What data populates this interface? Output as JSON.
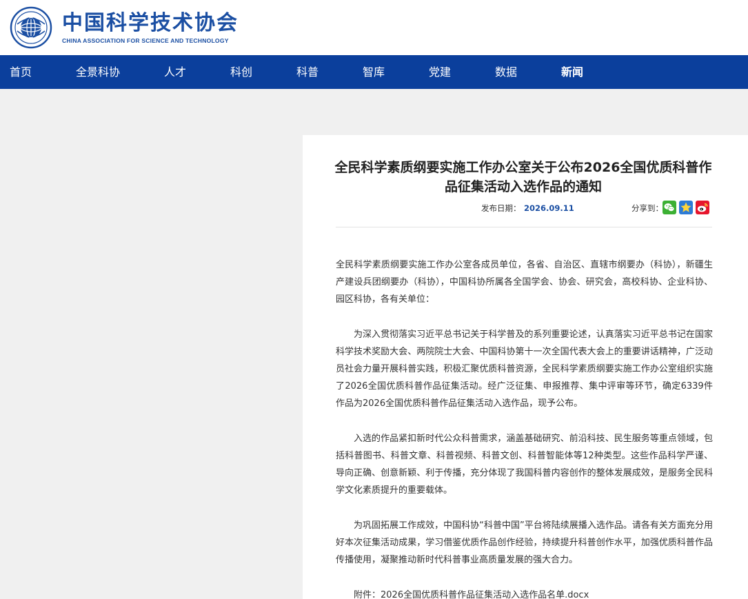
{
  "header": {
    "logo_cn": "中国科学技术协会",
    "logo_en": "CHINA ASSOCIATION FOR SCIENCE AND TECHNOLOGY"
  },
  "nav": {
    "items": [
      {
        "label": "首页"
      },
      {
        "label": "全景科协"
      },
      {
        "label": "人才"
      },
      {
        "label": "科创"
      },
      {
        "label": "科普"
      },
      {
        "label": "智库"
      },
      {
        "label": "党建"
      },
      {
        "label": "数据"
      },
      {
        "label": "新闻"
      }
    ],
    "active": "新闻"
  },
  "article": {
    "title": "全民科学素质纲要实施工作办公室关于公布2026全国优质科普作品征集活动入选作品的通知",
    "date_label": "发布日期：",
    "date": "2026.09.11",
    "share_label": "分享到：",
    "share_icons": [
      "wechat-icon",
      "qzone-icon",
      "weibo-icon"
    ],
    "paragraphs": [
      "全民科学素质纲要实施工作办公室各成员单位，各省、自治区、直辖市纲要办（科协），新疆生产建设兵团纲要办（科协），中国科协所属各全国学会、协会、研究会，高校科协、企业科协、园区科协，各有关单位：",
      "为深入贯彻落实习近平总书记关于科学普及的系列重要论述，认真落实习近平总书记在国家科学技术奖励大会、两院院士大会、中国科协第十一次全国代表大会上的重要讲话精神，广泛动员社会力量开展科普实践，积极汇聚优质科普资源，全民科学素质纲要实施工作办公室组织实施了2026全国优质科普作品征集活动。经广泛征集、申报推荐、集中评审等环节，确定6339件作品为2026全国优质科普作品征集活动入选作品，现予公布。",
      "入选的作品紧扣新时代公众科普需求，涵盖基础研究、前沿科技、民生服务等重点领域，包括科普图书、科普文章、科普视频、科普文创、科普智能体等12种类型。这些作品科学严谨、导向正确、创意新颖、利于传播，充分体现了我国科普内容创作的整体发展成效，是服务全民科学文化素质提升的重要载体。",
      "为巩固拓展工作成效，中国科协“科普中国”平台将陆续展播入选作品。请各有关方面充分用好本次征集活动成果，学习借鉴优质作品创作经验，持续提升科普创作水平，加强优质科普作品传播使用，凝聚推动新时代科普事业高质量发展的强大合力。"
    ],
    "attachment": "附件：2026全国优质科普作品征集活动入选作品名单.docx"
  },
  "colors": {
    "nav_bg": "#0b3f9c",
    "brand": "#1b4fa3",
    "page_bg": "#f0f0f0"
  }
}
